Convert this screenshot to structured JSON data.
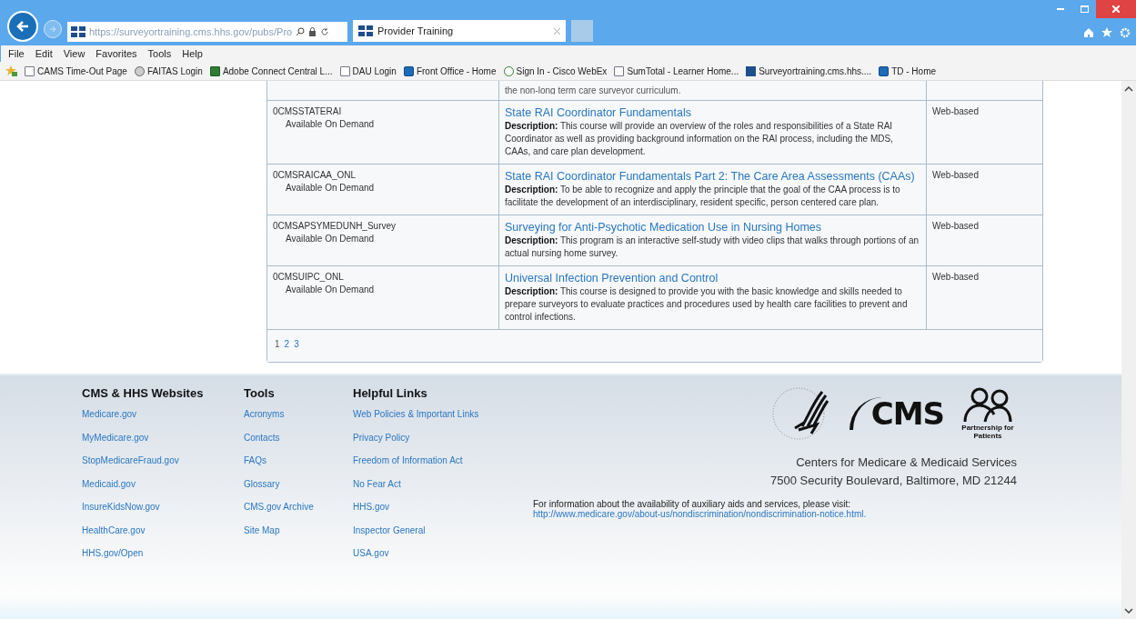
{
  "browser": {
    "address": "https://surveyortraining.cms.hhs.gov/pubs/Pro",
    "tab_title": "Provider Training",
    "menu": [
      "File",
      "Edit",
      "View",
      "Favorites",
      "Tools",
      "Help"
    ],
    "favorites": [
      {
        "label": "CAMS Time-Out Page",
        "kind": "page"
      },
      {
        "label": "FAITAS Login",
        "kind": "globe"
      },
      {
        "label": "Adobe Connect Central L...",
        "kind": "green"
      },
      {
        "label": "DAU Login",
        "kind": "page"
      },
      {
        "label": "Front Office - Home",
        "kind": "share"
      },
      {
        "label": "Sign In - Cisco WebEx",
        "kind": "webex"
      },
      {
        "label": "SumTotal - Learner Home...",
        "kind": "page"
      },
      {
        "label": "Surveyortraining.cms.hhs....",
        "kind": "cms"
      },
      {
        "label": "TD - Home",
        "kind": "share"
      }
    ]
  },
  "courses": {
    "partial_row_text": "the non-long term care surveyor curriculum.",
    "rows": [
      {
        "code": "0CMSSTATERAI",
        "availability": "Available On Demand",
        "title": "State RAI Coordinator Fundamentals",
        "description": "**Description:** This course will provide an overview of the roles and responsibilities of a State RAI Coordinator as well as providing background information on the RAI process, including the MDS, CAAs, and care plan development.",
        "delivery": "Web-based"
      },
      {
        "code": "0CMSRAICAA_ONL",
        "availability": "Available On Demand",
        "title": "State RAI Coordinator Fundamentals Part 2: The Care Area Assessments (CAAs)",
        "description": "**Description:** To be able to recognize and apply the principle that the goal of the CAA process is to facilitate the development of an interdisciplinary, resident specific, person centered care plan.",
        "delivery": "Web-based"
      },
      {
        "code": "0CMSAPSYMEDUNH_Survey",
        "availability": "Available On Demand",
        "title": "Surveying for Anti-Psychotic Medication Use in Nursing Homes",
        "description": "**Description:** This program is an interactive self-study with video clips that walks through portions of an actual nursing home survey.",
        "delivery": "Web-based"
      },
      {
        "code": "0CMSUIPC_ONL",
        "availability": "Available On Demand",
        "title": "Universal Infection Prevention and Control",
        "description": "**Description:** This course is designed to provide you with the basic knowledge and skills needed to prepare surveyors to evaluate practices and procedures used by health care facilities to prevent and control infections.",
        "delivery": "Web-based"
      }
    ],
    "pages": [
      {
        "label": "1",
        "selected": true
      },
      {
        "label": "2",
        "selected": false
      },
      {
        "label": "3",
        "selected": false
      }
    ]
  },
  "footer": {
    "columns": [
      {
        "heading": "CMS & HHS Websites",
        "links": [
          "Medicare.gov",
          "MyMedicare.gov",
          "StopMedicareFraud.gov",
          "Medicaid.gov",
          "InsureKidsNow.gov",
          "HealthCare.gov",
          "HHS.gov/Open"
        ]
      },
      {
        "heading": "Tools",
        "links": [
          "Acronyms",
          "Contacts",
          "FAQs",
          "Glossary",
          "CMS.gov Archive",
          "Site Map"
        ]
      },
      {
        "heading": "Helpful Links",
        "links": [
          "Web Policies & Important Links",
          "Privacy Policy",
          "Freedom of Information Act",
          "No Fear Act",
          "HHS.gov",
          "Inspector General",
          "USA.gov"
        ]
      }
    ],
    "cms_logo_text": "CMS",
    "partnership_logo_text": "Partnership for Patients",
    "address": [
      "Centers for Medicare & Medicaid Services",
      "7500 Security Boulevard, Baltimore, MD 21244"
    ],
    "notice": "For information about the availability of auxiliary aids and services, please visit:",
    "notice_link": "http://www.medicare.gov/about-us/nondiscrimination/nondiscrimination-notice.html."
  }
}
